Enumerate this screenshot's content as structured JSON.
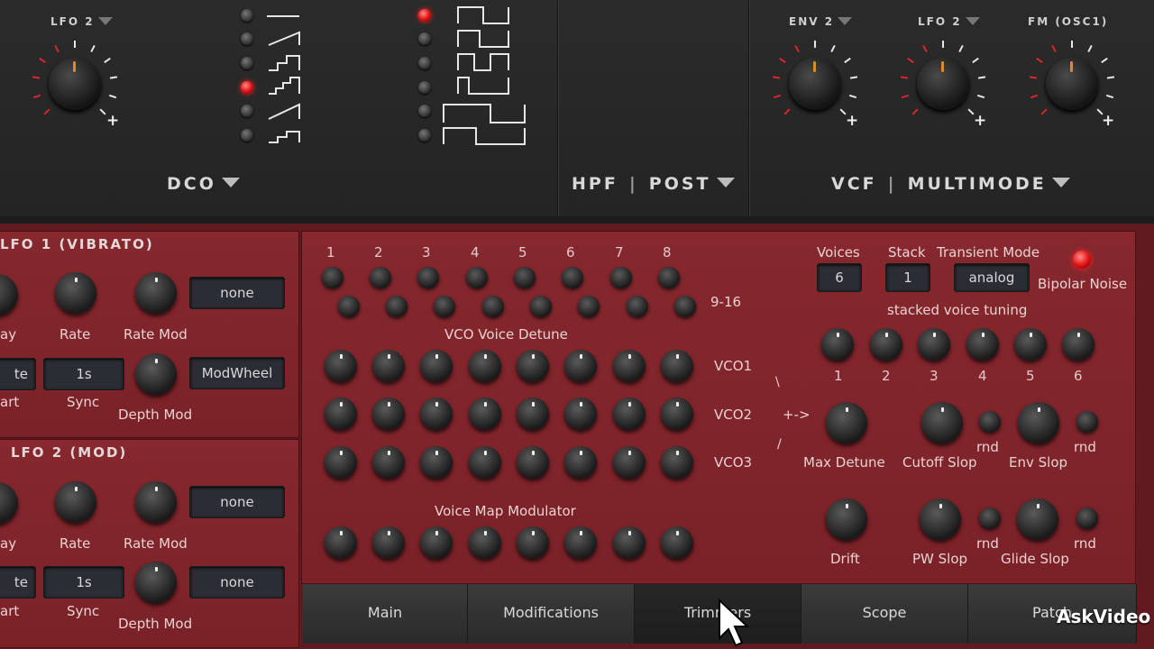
{
  "top": {
    "lfo2_label": "LFO 2",
    "dco_label": "DCO",
    "hpf_label": "HPF",
    "post_label": "POST",
    "vcf_label": "VCF",
    "multimode_label": "MULTIMODE",
    "env2_label": "ENV 2",
    "lfo2b_label": "LFO 2",
    "fm_label": "FM (OSC1)"
  },
  "lfo1": {
    "title": "LFO 1 (VIBRATO)",
    "delay": "ay",
    "rate": "Rate",
    "rate_mod": "Rate Mod",
    "rate_mod_value": "none",
    "start_value": "te",
    "start": "art",
    "sync_value": "1s",
    "sync": "Sync",
    "depth_mod": "Depth Mod",
    "depth_mod_value": "ModWheel"
  },
  "lfo2": {
    "title": "LFO 2 (MOD)",
    "delay": "ay",
    "rate": "Rate",
    "rate_mod": "Rate Mod",
    "rate_mod_value": "none",
    "start_value": "te",
    "start": "art",
    "sync_value": "1s",
    "sync": "Sync",
    "depth_mod": "Depth Mod",
    "depth_mod_value": "none"
  },
  "detune": {
    "numbers": [
      "1",
      "2",
      "3",
      "4",
      "5",
      "6",
      "7",
      "8"
    ],
    "range_label": "9-16",
    "vco_voice_detune": "VCO Voice Detune",
    "vco1": "VCO1",
    "vco2": "VCO2",
    "vco3": "VCO3",
    "voice_map_modulator": "Voice Map Modulator"
  },
  "right": {
    "voices_label": "Voices",
    "voices_value": "6",
    "stack_label": "Stack",
    "stack_value": "1",
    "transient_label": "Transient Mode",
    "transient_value": "analog",
    "bipolar_noise": "Bipolar Noise",
    "stacked_tuning": "stacked voice tuning",
    "tuning_numbers": [
      "1",
      "2",
      "3",
      "4",
      "5",
      "6"
    ],
    "arrow_text": "+->",
    "max_detune": "Max Detune",
    "cutoff_slop": "Cutoff Slop",
    "env_slop": "Env Slop",
    "rnd": "rnd",
    "drift": "Drift",
    "pw_slop": "PW Slop",
    "glide_slop": "Glide Slop"
  },
  "tabs": [
    "Main",
    "Modifications",
    "Trimmers",
    "Scope",
    "Patch"
  ],
  "watermark": "AskVideo"
}
